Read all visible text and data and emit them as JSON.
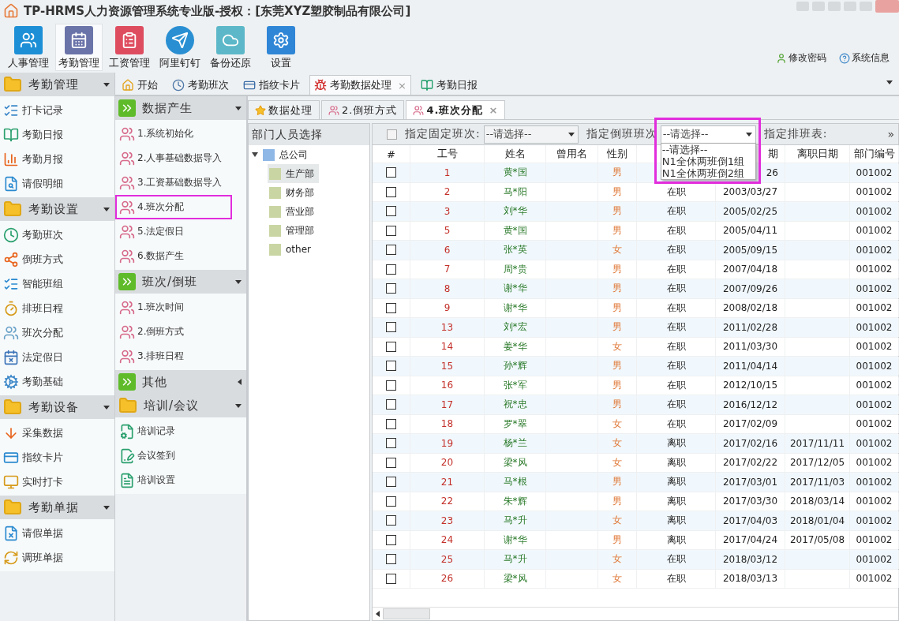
{
  "window": {
    "title": "TP-HRMS人力资源管理系统专业版-授权：[东莞XYZ塑胶制品有限公司]"
  },
  "toolbar": {
    "buttons": [
      {
        "label": "人事管理",
        "selected": false
      },
      {
        "label": "考勤管理",
        "selected": true
      },
      {
        "label": "工资管理",
        "selected": false
      },
      {
        "label": "阿里钉钉",
        "selected": false
      },
      {
        "label": "备份还原",
        "selected": false
      },
      {
        "label": "设置",
        "selected": false
      }
    ],
    "links": [
      "修改密码",
      "系统信息"
    ]
  },
  "sidebar": {
    "groups": [
      {
        "title": "考勤管理",
        "expanded": true,
        "items": [
          "打卡记录",
          "考勤日报",
          "考勤月报",
          "请假明细"
        ]
      },
      {
        "title": "考勤设置",
        "expanded": true,
        "items": [
          "考勤班次",
          "倒班方式",
          "智能班组",
          "排班日程",
          "班次分配",
          "法定假日",
          "考勤基础"
        ]
      },
      {
        "title": "考勤设备",
        "expanded": true,
        "items": [
          "采集数据",
          "指纹卡片",
          "实时打卡"
        ]
      },
      {
        "title": "考勤单据",
        "expanded": true,
        "items": [
          "请假单据",
          "调班单据"
        ]
      }
    ]
  },
  "tabs": [
    {
      "label": "开始",
      "selected": false
    },
    {
      "label": "考勤班次",
      "selected": false
    },
    {
      "label": "指纹卡片",
      "selected": false
    },
    {
      "label": "考勤数据处理",
      "selected": true,
      "close": "×"
    },
    {
      "label": "考勤日报",
      "selected": false
    }
  ],
  "nav": {
    "groups": [
      {
        "title": "数据产生",
        "kind": "chevrons",
        "expanded": true,
        "items": [
          {
            "label": "1.系统初始化",
            "highlighted": false
          },
          {
            "label": "2.人事基础数据导入",
            "highlighted": false
          },
          {
            "label": "3.工资基础数据导入",
            "highlighted": false
          },
          {
            "label": "4.班次分配",
            "highlighted": true
          },
          {
            "label": "5.法定假日",
            "highlighted": false
          },
          {
            "label": "6.数据产生",
            "highlighted": false
          }
        ]
      },
      {
        "title": "班次/倒班",
        "kind": "chevrons",
        "expanded": true,
        "items": [
          {
            "label": "1.班次时间",
            "highlighted": false
          },
          {
            "label": "2.倒班方式",
            "highlighted": false
          },
          {
            "label": "3.排班日程",
            "highlighted": false
          }
        ]
      },
      {
        "title": "其他",
        "kind": "chevrons",
        "expanded": false
      },
      {
        "title": "培训/会议",
        "kind": "folder",
        "expanded": true,
        "items": [
          {
            "label": "培训记录",
            "highlighted": false
          },
          {
            "label": "会议签到",
            "highlighted": false
          },
          {
            "label": "培训设置",
            "highlighted": false
          }
        ]
      }
    ]
  },
  "subtabs": [
    {
      "label": "数据处理",
      "selected": false
    },
    {
      "label": "2.倒班方式",
      "selected": false
    },
    {
      "label": "4.班次分配",
      "selected": true,
      "close": "×"
    }
  ],
  "department_panel": {
    "title": "部门人员选择",
    "tree": [
      {
        "label": "总公司",
        "expanded": true,
        "selected": false,
        "children": [
          {
            "label": "生产部",
            "selected": true
          },
          {
            "label": "财务部",
            "selected": false
          },
          {
            "label": "营业部",
            "selected": false
          },
          {
            "label": "管理部",
            "selected": false
          },
          {
            "label": "other",
            "selected": false
          }
        ]
      }
    ]
  },
  "filter_bar": {
    "select_all_checked": false,
    "fixed_shift": {
      "label": "指定固定班次:",
      "value": "--请选择--"
    },
    "rotating_shift": {
      "label": "指定倒班班次",
      "value": "--请选择--",
      "open": true,
      "highlighted": true,
      "options": [
        "--请选择--",
        "N1全休两班倒1组",
        "N1全休两班倒2组"
      ]
    },
    "schedule": {
      "label": "指定排班表:"
    },
    "overflow": "»"
  },
  "table": {
    "columns": [
      {
        "label": "#"
      },
      {
        "label": "工号"
      },
      {
        "label": "姓名"
      },
      {
        "label": "曾用名"
      },
      {
        "label": "性别"
      },
      {},
      {
        "label": "期"
      },
      {
        "label": "离职日期"
      },
      {
        "label": "部门编号"
      }
    ],
    "rows": [
      {
        "checked": false,
        "id": "1",
        "name": "黄*国",
        "gender": "男",
        "hired": "26",
        "dept": "001002"
      },
      {
        "checked": false,
        "id": "2",
        "name": "马*阳",
        "gender": "男",
        "status": "在职",
        "hired": "2003/03/27",
        "dept": "001002"
      },
      {
        "checked": false,
        "id": "3",
        "name": "刘*华",
        "gender": "男",
        "status": "在职",
        "hired": "2005/02/25",
        "dept": "001002"
      },
      {
        "checked": false,
        "id": "5",
        "name": "黄*国",
        "gender": "男",
        "status": "在职",
        "hired": "2005/04/11",
        "dept": "001002"
      },
      {
        "checked": false,
        "id": "6",
        "name": "张*英",
        "gender": "女",
        "status": "在职",
        "hired": "2005/09/15",
        "dept": "001002"
      },
      {
        "checked": false,
        "id": "7",
        "name": "周*贵",
        "gender": "男",
        "status": "在职",
        "hired": "2007/04/18",
        "dept": "001002"
      },
      {
        "checked": false,
        "id": "8",
        "name": "谢*华",
        "gender": "男",
        "status": "在职",
        "hired": "2007/09/26",
        "dept": "001002"
      },
      {
        "checked": false,
        "id": "9",
        "name": "谢*华",
        "gender": "男",
        "status": "在职",
        "hired": "2008/02/18",
        "dept": "001002"
      },
      {
        "checked": false,
        "id": "13",
        "name": "刘*宏",
        "gender": "男",
        "status": "在职",
        "hired": "2011/02/28",
        "dept": "001002"
      },
      {
        "checked": false,
        "id": "14",
        "name": "姜*华",
        "gender": "女",
        "status": "在职",
        "hired": "2011/03/30",
        "dept": "001002"
      },
      {
        "checked": false,
        "id": "15",
        "name": "孙*辉",
        "gender": "男",
        "status": "在职",
        "hired": "2011/04/14",
        "dept": "001002"
      },
      {
        "checked": false,
        "id": "16",
        "name": "张*军",
        "gender": "男",
        "status": "在职",
        "hired": "2012/10/15",
        "dept": "001002"
      },
      {
        "checked": false,
        "id": "17",
        "name": "祝*忠",
        "gender": "男",
        "status": "在职",
        "hired": "2016/12/12",
        "dept": "001002"
      },
      {
        "checked": false,
        "id": "18",
        "name": "罗*翠",
        "gender": "女",
        "status": "在职",
        "hired": "2017/02/09",
        "dept": "001002"
      },
      {
        "checked": false,
        "id": "19",
        "name": "杨*兰",
        "gender": "女",
        "status": "离职",
        "hired": "2017/02/16",
        "left": "2017/11/11",
        "dept": "001002"
      },
      {
        "checked": false,
        "id": "20",
        "name": "梁*风",
        "gender": "女",
        "status": "离职",
        "hired": "2017/02/22",
        "left": "2017/12/05",
        "dept": "001002"
      },
      {
        "checked": false,
        "id": "21",
        "name": "马*根",
        "gender": "男",
        "status": "离职",
        "hired": "2017/03/01",
        "left": "2017/11/03",
        "dept": "001002"
      },
      {
        "checked": false,
        "id": "22",
        "name": "朱*辉",
        "gender": "男",
        "status": "离职",
        "hired": "2017/03/30",
        "left": "2018/03/14",
        "dept": "001002"
      },
      {
        "checked": false,
        "id": "23",
        "name": "马*升",
        "gender": "女",
        "status": "离职",
        "hired": "2017/04/03",
        "left": "2018/01/04",
        "dept": "001002"
      },
      {
        "checked": false,
        "id": "24",
        "name": "谢*华",
        "gender": "男",
        "status": "离职",
        "hired": "2017/04/24",
        "left": "2017/05/08",
        "dept": "001002"
      },
      {
        "checked": false,
        "id": "25",
        "name": "马*升",
        "gender": "女",
        "status": "在职",
        "hired": "2018/03/12",
        "dept": "001002"
      },
      {
        "checked": false,
        "id": "26",
        "name": "梁*风",
        "gender": "女",
        "status": "在职",
        "hired": "2018/03/13",
        "dept": "001002"
      }
    ]
  }
}
